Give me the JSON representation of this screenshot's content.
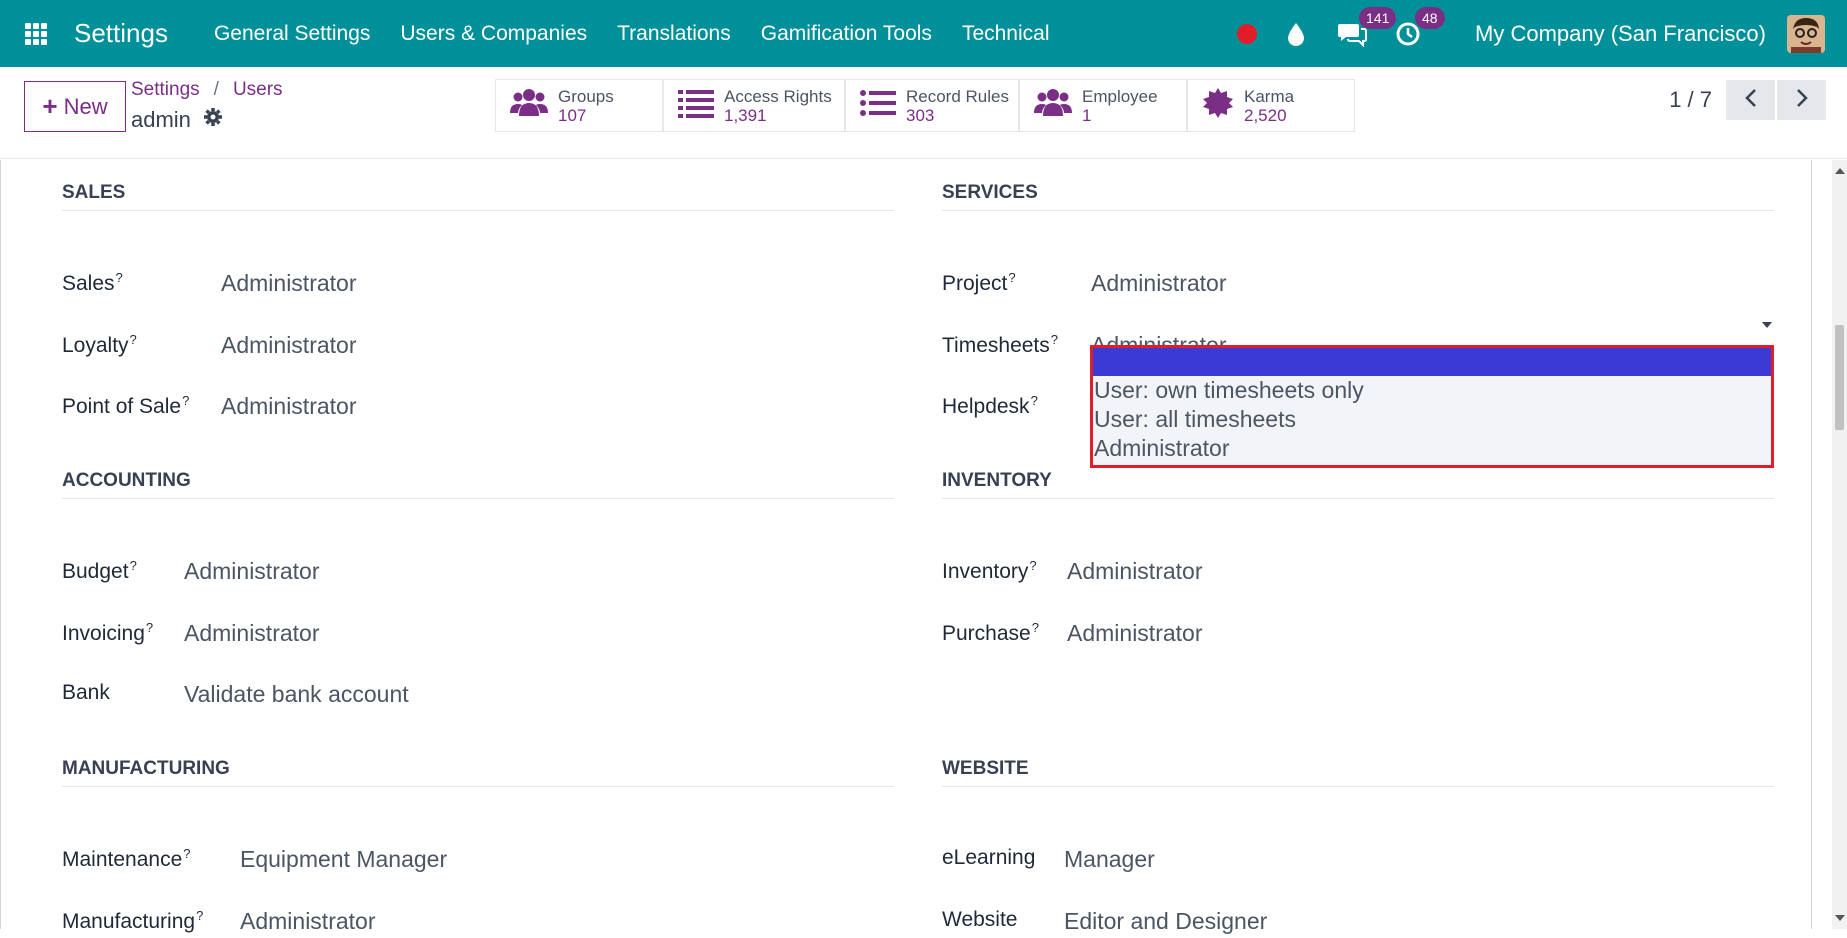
{
  "navbar": {
    "app_title": "Settings",
    "menu": [
      "General Settings",
      "Users & Companies",
      "Translations",
      "Gamification Tools",
      "Technical"
    ],
    "messages_count": "141",
    "activities_count": "48",
    "company": "My Company (San Francisco)"
  },
  "control": {
    "new_label": "New",
    "breadcrumb": [
      "Settings",
      "Users"
    ],
    "breadcrumb_sep": "/",
    "record_name": "admin",
    "smart_buttons": [
      {
        "label": "Groups",
        "value": "107",
        "icon": "users-icon"
      },
      {
        "label": "Access Rights",
        "value": "1,391",
        "icon": "list-icon"
      },
      {
        "label": "Record Rules",
        "value": "303",
        "icon": "list-icon"
      },
      {
        "label": "Employee",
        "value": "1",
        "icon": "users-icon"
      },
      {
        "label": "Karma",
        "value": "2,520",
        "icon": "badge-icon"
      }
    ],
    "pager": "1 / 7"
  },
  "sections": {
    "sales": {
      "title": "SALES",
      "fields": [
        {
          "label": "Sales",
          "help": "?",
          "value": "Administrator"
        },
        {
          "label": "Loyalty",
          "help": "?",
          "value": "Administrator"
        },
        {
          "label": "Point of Sale",
          "help": "?",
          "value": "Administrator"
        }
      ]
    },
    "services": {
      "title": "SERVICES",
      "fields": [
        {
          "label": "Project",
          "help": "?",
          "value": "Administrator"
        },
        {
          "label": "Timesheets",
          "help": "?",
          "value": "Administrator"
        },
        {
          "label": "Helpdesk",
          "help": "?",
          "value": ""
        }
      ]
    },
    "accounting": {
      "title": "ACCOUNTING",
      "fields": [
        {
          "label": "Budget",
          "help": "?",
          "value": "Administrator"
        },
        {
          "label": "Invoicing",
          "help": "?",
          "value": "Administrator"
        },
        {
          "label": "Bank",
          "help": "",
          "value": "Validate bank account"
        }
      ]
    },
    "inventory": {
      "title": "INVENTORY",
      "fields": [
        {
          "label": "Inventory",
          "help": "?",
          "value": "Administrator"
        },
        {
          "label": "Purchase",
          "help": "?",
          "value": "Administrator"
        }
      ]
    },
    "manufacturing": {
      "title": "MANUFACTURING",
      "fields": [
        {
          "label": "Maintenance",
          "help": "?",
          "value": "Equipment Manager"
        },
        {
          "label": "Manufacturing",
          "help": "?",
          "value": "Administrator"
        }
      ]
    },
    "website": {
      "title": "WEBSITE",
      "fields": [
        {
          "label": "eLearning",
          "help": "",
          "value": "Manager"
        },
        {
          "label": "Website",
          "help": "",
          "value": "Editor and Designer"
        }
      ]
    }
  },
  "timesheets_dropdown": {
    "options": [
      "",
      "User: own timesheets only",
      "User: all timesheets",
      "Administrator"
    ]
  },
  "colors": {
    "navbar": "#00909a",
    "accent": "#7b2e86",
    "highlight_border": "#e11d2a",
    "selected_option": "#3a3ad6"
  }
}
